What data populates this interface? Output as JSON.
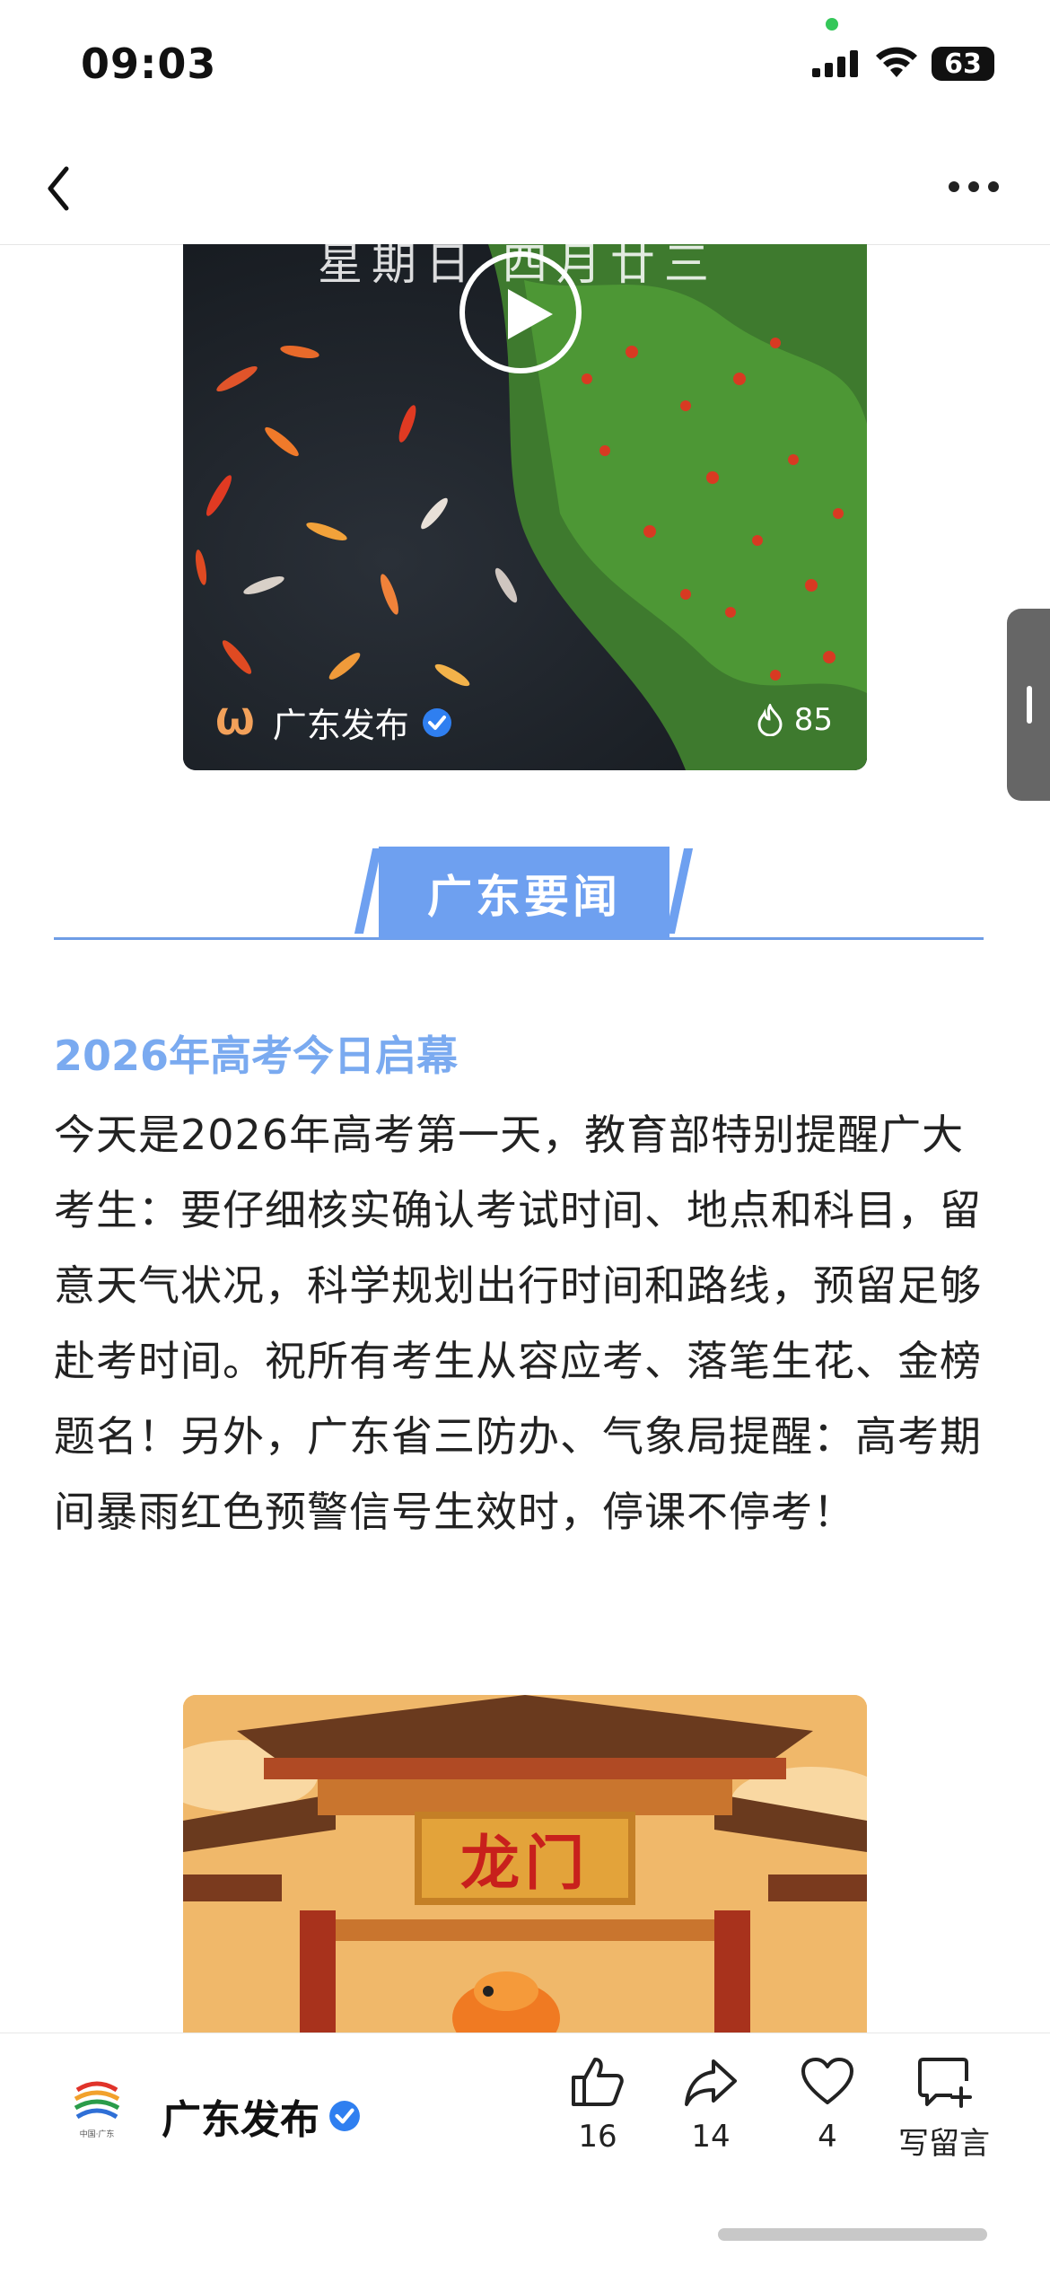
{
  "status_bar": {
    "time": "09:03",
    "battery": "63"
  },
  "video": {
    "caption": "星期日 四月廿三",
    "brand": "广东发布",
    "hot_count": "85"
  },
  "section": {
    "title": "广东要闻"
  },
  "article": {
    "title": "2026年高考今日启幕",
    "body": "今天是2026年高考第一天，教育部特别提醒广大考生：要仔细核实确认考试时间、地点和科目，留意天气状况，科学规划出行时间和路线，预留足够赴考时间。祝所有考生从容应考、落笔生花、金榜题名！另外，广东省三防办、气象局提醒：高考期间暴雨红色预警信号生效时，停课不停考！"
  },
  "image": {
    "plaque_text": "龙门"
  },
  "bottom_bar": {
    "account_name": "广东发布",
    "logo_caption": "中国·广东",
    "like_count": "16",
    "share_count": "14",
    "favorite_count": "4",
    "comment_label": "写留言"
  },
  "colors": {
    "accent": "#6ea0f0",
    "title": "#7aaaf0",
    "verify": "#2f7ff0"
  },
  "icons": [
    "back-icon",
    "more-icon",
    "play-icon",
    "verified-icon",
    "flame-icon",
    "thumb-up-icon",
    "share-icon",
    "heart-icon",
    "comment-add-icon"
  ]
}
